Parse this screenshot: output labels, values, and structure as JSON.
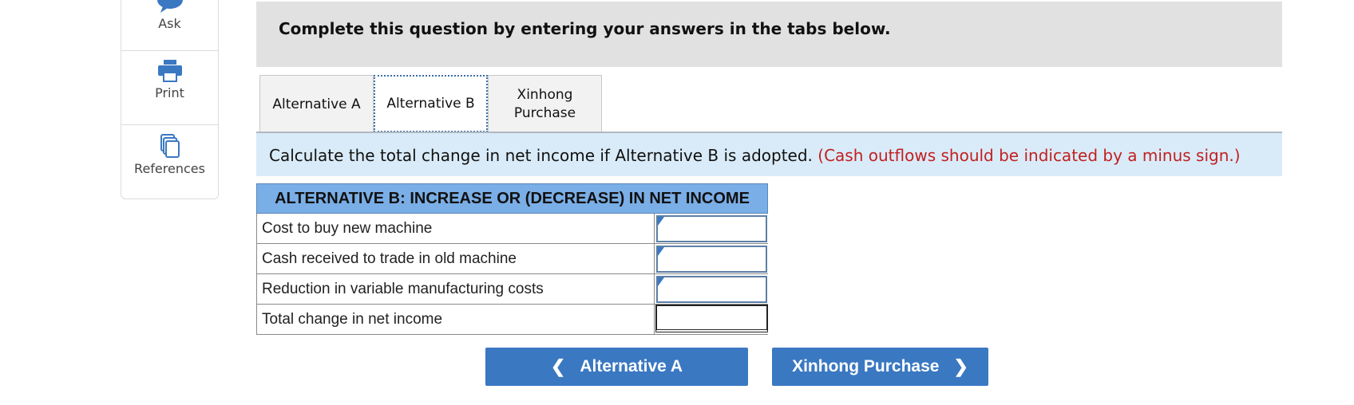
{
  "tools": [
    {
      "label": "Ask",
      "icon": "speech-bubble-icon"
    },
    {
      "label": "Print",
      "icon": "printer-icon"
    },
    {
      "label": "References",
      "icon": "documents-icon"
    }
  ],
  "banner": {
    "text": "Complete this question by entering your answers in the tabs below."
  },
  "tabs": [
    {
      "label": "Alternative A",
      "active": false
    },
    {
      "label": "Alternative B",
      "active": true
    },
    {
      "label": "Xinhong\nPurchase",
      "active": false
    }
  ],
  "instruction": {
    "text": "Calculate the total change in net income if Alternative B is adopted.",
    "note": "(Cash outflows should be indicated by a minus sign.)"
  },
  "table": {
    "header": "ALTERNATIVE B: INCREASE OR (DECREASE) IN NET INCOME",
    "rows": [
      {
        "label": "Cost to buy new machine",
        "value": ""
      },
      {
        "label": "Cash received to trade in old machine",
        "value": ""
      },
      {
        "label": "Reduction in variable manufacturing costs",
        "value": ""
      },
      {
        "label": "Total change in net income",
        "value": ""
      }
    ]
  },
  "nav": {
    "prev_label": "Alternative A",
    "next_label": "Xinhong Purchase"
  },
  "colors": {
    "accent": "#3a78c2",
    "note_red": "#c21f1f",
    "header_blue": "#7aaee6"
  }
}
